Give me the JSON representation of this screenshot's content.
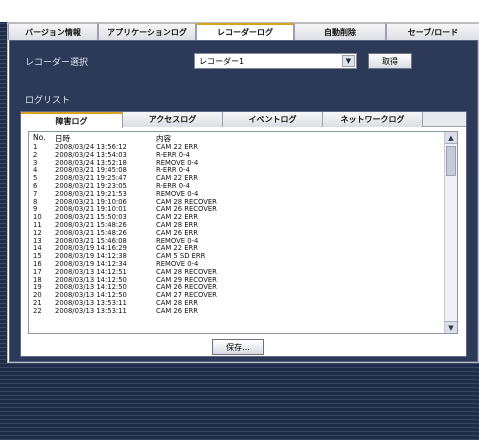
{
  "main_tabs": [
    {
      "label": "バージョン情報"
    },
    {
      "label": "アプリケーションログ"
    },
    {
      "label": "レコーダーログ"
    },
    {
      "label": "自動削除"
    },
    {
      "label": "セーブ/ロード"
    }
  ],
  "recorder_select": {
    "label": "レコーダー選択",
    "value": "レコーダー1",
    "get_button": "取得"
  },
  "log_list": {
    "label": "ログリスト",
    "tabs": [
      {
        "label": "障害ログ"
      },
      {
        "label": "アクセスログ"
      },
      {
        "label": "イベントログ"
      },
      {
        "label": "ネットワークログ"
      }
    ],
    "headers": {
      "no": "No.",
      "datetime": "日時",
      "content": "内容"
    },
    "rows": [
      {
        "no": "1",
        "datetime": "2008/03/24 13:56:12",
        "content": "CAM 22 ERR"
      },
      {
        "no": "2",
        "datetime": "2008/03/24 13:54:03",
        "content": "R-ERR 0-4"
      },
      {
        "no": "3",
        "datetime": "2008/03/24 13:52:18",
        "content": "REMOVE 0-4"
      },
      {
        "no": "4",
        "datetime": "2008/03/21 19:45:08",
        "content": "R-ERR 0-4"
      },
      {
        "no": "5",
        "datetime": "2008/03/21 19:25:47",
        "content": "CAM 22 ERR"
      },
      {
        "no": "6",
        "datetime": "2008/03/21 19:23:05",
        "content": "R-ERR 0-4"
      },
      {
        "no": "7",
        "datetime": "2008/03/21 19:21:53",
        "content": "REMOVE 0-4"
      },
      {
        "no": "8",
        "datetime": "2008/03/21 19:10:06",
        "content": "CAM 28 RECOVER"
      },
      {
        "no": "9",
        "datetime": "2008/03/21 19:10:01",
        "content": "CAM 26 RECOVER"
      },
      {
        "no": "10",
        "datetime": "2008/03/21 15:50:03",
        "content": "CAM 22 ERR"
      },
      {
        "no": "11",
        "datetime": "2008/03/21 15:48:26",
        "content": "CAM 28 ERR"
      },
      {
        "no": "12",
        "datetime": "2008/03/21 15:48:26",
        "content": "CAM 26 ERR"
      },
      {
        "no": "13",
        "datetime": "2008/03/21 15:46:08",
        "content": "REMOVE 0-4"
      },
      {
        "no": "14",
        "datetime": "2008/03/19 14:16:29",
        "content": "CAM 22 ERR"
      },
      {
        "no": "15",
        "datetime": "2008/03/19 14:12:38",
        "content": "CAM 5 SD ERR"
      },
      {
        "no": "16",
        "datetime": "2008/03/19 14:12:34",
        "content": "REMOVE 0-4"
      },
      {
        "no": "17",
        "datetime": "2008/03/13 14:12:51",
        "content": "CAM 28 RECOVER"
      },
      {
        "no": "18",
        "datetime": "2008/03/13 14:12:50",
        "content": "CAM 29 RECOVER"
      },
      {
        "no": "19",
        "datetime": "2008/03/13 14:12:50",
        "content": "CAM 26 RECOVER"
      },
      {
        "no": "20",
        "datetime": "2008/03/13 14:12:50",
        "content": "CAM 27 RECOVER"
      },
      {
        "no": "21",
        "datetime": "2008/03/13 13:53:11",
        "content": "CAM 28 ERR"
      },
      {
        "no": "22",
        "datetime": "2008/03/13 13:53:11",
        "content": "CAM 26 ERR"
      }
    ],
    "save_button": "保存..."
  },
  "icons": {
    "dropdown": "chevron-down-icon",
    "scroll_up": "chevron-up-icon",
    "scroll_down": "chevron-down-icon"
  },
  "colors": {
    "background": "#1e2b46",
    "panel": "#2c3a57",
    "active_tab_accent": "#d9a11e"
  }
}
